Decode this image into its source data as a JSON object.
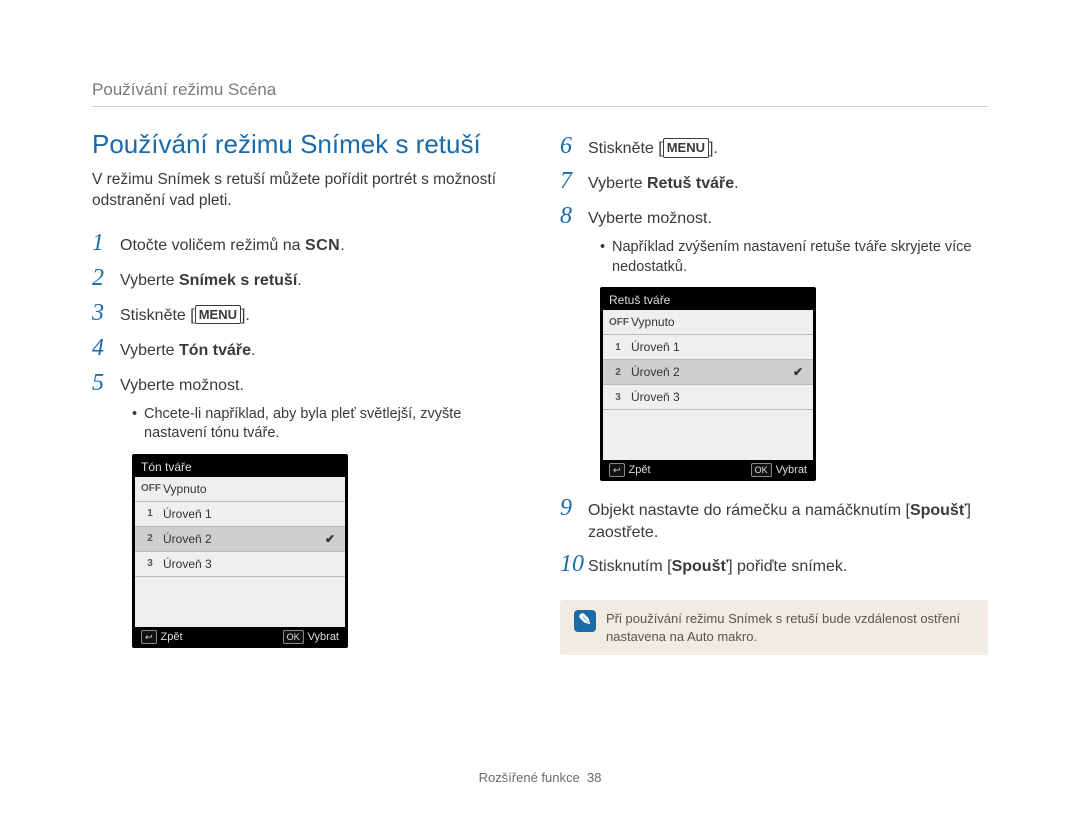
{
  "breadcrumb": "Používání režimu Scéna",
  "section_title": "Používání režimu Snímek s retuší",
  "intro": "V režimu Snímek s retuší můžete pořídit portrét s možností odstranění vad pleti.",
  "glyphs": {
    "scn": "SCN",
    "menu": "MENU"
  },
  "left_steps": {
    "s1": {
      "num": "1",
      "pre": "Otočte voličem režimů na ",
      "post": "."
    },
    "s2": {
      "num": "2",
      "pre": "Vyberte ",
      "bold": "Snímek s retuší",
      "post": "."
    },
    "s3": {
      "num": "3",
      "pre": "Stiskněte [",
      "post": "]."
    },
    "s4": {
      "num": "4",
      "pre": "Vyberte ",
      "bold": "Tón tváře",
      "post": "."
    },
    "s5": {
      "num": "5",
      "text": "Vyberte možnost.",
      "sub": "Chcete-li například, aby byla pleť světlejší, zvyšte nastavení tónu tváře."
    }
  },
  "right_steps": {
    "s6": {
      "num": "6",
      "pre": "Stiskněte [",
      "post": "]."
    },
    "s7": {
      "num": "7",
      "pre": "Vyberte ",
      "bold": "Retuš tváře",
      "post": "."
    },
    "s8": {
      "num": "8",
      "text": "Vyberte možnost.",
      "sub": "Například zvýšením nastavení retuše tváře skryjete více nedostatků."
    },
    "s9": {
      "num": "9",
      "pre": "Objekt nastavte do rámečku a namáčknutím [",
      "bold": "Spoušť",
      "post": "] zaostřete."
    },
    "s10": {
      "num": "10",
      "pre": "Stisknutím [",
      "bold": "Spoušť",
      "post": "] pořiďte snímek."
    }
  },
  "lcd_left": {
    "title": "Tón tváře",
    "rows": [
      {
        "icon": "OFF",
        "label": "Vypnuto",
        "selected": false
      },
      {
        "icon": "1",
        "label": "Úroveň 1",
        "selected": false
      },
      {
        "icon": "2",
        "label": "Úroveň 2",
        "selected": true
      },
      {
        "icon": "3",
        "label": "Úroveň 3",
        "selected": false
      }
    ],
    "back_key": "↩",
    "back": "Zpět",
    "ok_key": "OK",
    "ok": "Vybrat"
  },
  "lcd_right": {
    "title": "Retuš tváře",
    "rows": [
      {
        "icon": "OFF",
        "label": "Vypnuto",
        "selected": false
      },
      {
        "icon": "1",
        "label": "Úroveň 1",
        "selected": false
      },
      {
        "icon": "2",
        "label": "Úroveň 2",
        "selected": true
      },
      {
        "icon": "3",
        "label": "Úroveň 3",
        "selected": false
      }
    ],
    "back_key": "↩",
    "back": "Zpět",
    "ok_key": "OK",
    "ok": "Vybrat"
  },
  "note": "Při používání režimu Snímek s retuší bude vzdálenost ostření nastavena na Auto makro.",
  "footer": {
    "section": "Rozšířené funkce",
    "page": "38"
  }
}
